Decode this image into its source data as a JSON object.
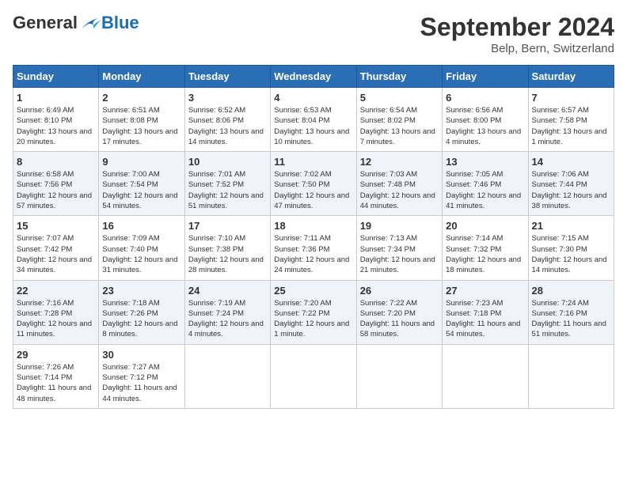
{
  "header": {
    "logo_general": "General",
    "logo_blue": "Blue",
    "month_title": "September 2024",
    "subtitle": "Belp, Bern, Switzerland"
  },
  "weekdays": [
    "Sunday",
    "Monday",
    "Tuesday",
    "Wednesday",
    "Thursday",
    "Friday",
    "Saturday"
  ],
  "weeks": [
    [
      {
        "day": "1",
        "sunrise": "6:49 AM",
        "sunset": "8:10 PM",
        "daylight": "13 hours and 20 minutes."
      },
      {
        "day": "2",
        "sunrise": "6:51 AM",
        "sunset": "8:08 PM",
        "daylight": "13 hours and 17 minutes."
      },
      {
        "day": "3",
        "sunrise": "6:52 AM",
        "sunset": "8:06 PM",
        "daylight": "13 hours and 14 minutes."
      },
      {
        "day": "4",
        "sunrise": "6:53 AM",
        "sunset": "8:04 PM",
        "daylight": "13 hours and 10 minutes."
      },
      {
        "day": "5",
        "sunrise": "6:54 AM",
        "sunset": "8:02 PM",
        "daylight": "13 hours and 7 minutes."
      },
      {
        "day": "6",
        "sunrise": "6:56 AM",
        "sunset": "8:00 PM",
        "daylight": "13 hours and 4 minutes."
      },
      {
        "day": "7",
        "sunrise": "6:57 AM",
        "sunset": "7:58 PM",
        "daylight": "13 hours and 1 minute."
      }
    ],
    [
      {
        "day": "8",
        "sunrise": "6:58 AM",
        "sunset": "7:56 PM",
        "daylight": "12 hours and 57 minutes."
      },
      {
        "day": "9",
        "sunrise": "7:00 AM",
        "sunset": "7:54 PM",
        "daylight": "12 hours and 54 minutes."
      },
      {
        "day": "10",
        "sunrise": "7:01 AM",
        "sunset": "7:52 PM",
        "daylight": "12 hours and 51 minutes."
      },
      {
        "day": "11",
        "sunrise": "7:02 AM",
        "sunset": "7:50 PM",
        "daylight": "12 hours and 47 minutes."
      },
      {
        "day": "12",
        "sunrise": "7:03 AM",
        "sunset": "7:48 PM",
        "daylight": "12 hours and 44 minutes."
      },
      {
        "day": "13",
        "sunrise": "7:05 AM",
        "sunset": "7:46 PM",
        "daylight": "12 hours and 41 minutes."
      },
      {
        "day": "14",
        "sunrise": "7:06 AM",
        "sunset": "7:44 PM",
        "daylight": "12 hours and 38 minutes."
      }
    ],
    [
      {
        "day": "15",
        "sunrise": "7:07 AM",
        "sunset": "7:42 PM",
        "daylight": "12 hours and 34 minutes."
      },
      {
        "day": "16",
        "sunrise": "7:09 AM",
        "sunset": "7:40 PM",
        "daylight": "12 hours and 31 minutes."
      },
      {
        "day": "17",
        "sunrise": "7:10 AM",
        "sunset": "7:38 PM",
        "daylight": "12 hours and 28 minutes."
      },
      {
        "day": "18",
        "sunrise": "7:11 AM",
        "sunset": "7:36 PM",
        "daylight": "12 hours and 24 minutes."
      },
      {
        "day": "19",
        "sunrise": "7:13 AM",
        "sunset": "7:34 PM",
        "daylight": "12 hours and 21 minutes."
      },
      {
        "day": "20",
        "sunrise": "7:14 AM",
        "sunset": "7:32 PM",
        "daylight": "12 hours and 18 minutes."
      },
      {
        "day": "21",
        "sunrise": "7:15 AM",
        "sunset": "7:30 PM",
        "daylight": "12 hours and 14 minutes."
      }
    ],
    [
      {
        "day": "22",
        "sunrise": "7:16 AM",
        "sunset": "7:28 PM",
        "daylight": "12 hours and 11 minutes."
      },
      {
        "day": "23",
        "sunrise": "7:18 AM",
        "sunset": "7:26 PM",
        "daylight": "12 hours and 8 minutes."
      },
      {
        "day": "24",
        "sunrise": "7:19 AM",
        "sunset": "7:24 PM",
        "daylight": "12 hours and 4 minutes."
      },
      {
        "day": "25",
        "sunrise": "7:20 AM",
        "sunset": "7:22 PM",
        "daylight": "12 hours and 1 minute."
      },
      {
        "day": "26",
        "sunrise": "7:22 AM",
        "sunset": "7:20 PM",
        "daylight": "11 hours and 58 minutes."
      },
      {
        "day": "27",
        "sunrise": "7:23 AM",
        "sunset": "7:18 PM",
        "daylight": "11 hours and 54 minutes."
      },
      {
        "day": "28",
        "sunrise": "7:24 AM",
        "sunset": "7:16 PM",
        "daylight": "11 hours and 51 minutes."
      }
    ],
    [
      {
        "day": "29",
        "sunrise": "7:26 AM",
        "sunset": "7:14 PM",
        "daylight": "11 hours and 48 minutes."
      },
      {
        "day": "30",
        "sunrise": "7:27 AM",
        "sunset": "7:12 PM",
        "daylight": "11 hours and 44 minutes."
      },
      null,
      null,
      null,
      null,
      null
    ]
  ]
}
